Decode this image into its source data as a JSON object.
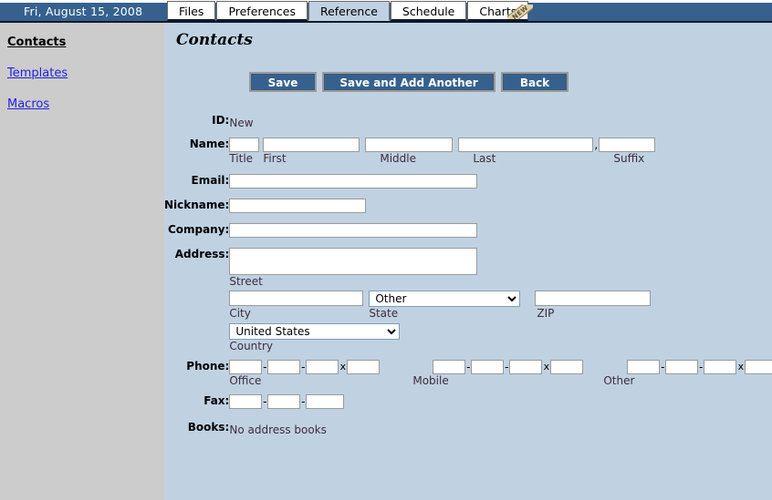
{
  "header": {
    "date": "Fri, August 15, 2008",
    "tabs": [
      {
        "label": "Files",
        "selected": false,
        "badge": null
      },
      {
        "label": "Preferences",
        "selected": false,
        "badge": null
      },
      {
        "label": "Reference",
        "selected": true,
        "badge": null
      },
      {
        "label": "Schedule",
        "selected": false,
        "badge": null
      },
      {
        "label": "Charts",
        "selected": false,
        "badge": "NEW"
      }
    ]
  },
  "sidebar": {
    "items": [
      {
        "label": "Contacts",
        "current": true
      },
      {
        "label": "Templates",
        "current": false
      },
      {
        "label": "Macros",
        "current": false
      }
    ]
  },
  "main": {
    "title": "Contacts",
    "buttons": {
      "save": "Save",
      "save_add_another": "Save and Add Another",
      "back": "Back"
    },
    "fields": {
      "id_label": "ID:",
      "id_value": "New",
      "name_label": "Name:",
      "name_title": "",
      "name_first": "",
      "name_middle": "",
      "name_last": "",
      "name_suffix": "",
      "name_separator": ",",
      "sub_title": "Title",
      "sub_first": "First",
      "sub_middle": "Middle",
      "sub_last": "Last",
      "sub_suffix": "Suffix",
      "email_label": "Email:",
      "email_value": "",
      "nickname_label": "Nickname:",
      "nickname_value": "",
      "company_label": "Company:",
      "company_value": "",
      "address_label": "Address:",
      "street_value": "",
      "sub_street": "Street",
      "city_value": "",
      "sub_city": "City",
      "state_value": "Other",
      "sub_state": "State",
      "zip_value": "",
      "sub_zip": "ZIP",
      "country_value": "United States",
      "sub_country": "Country",
      "phone_label": "Phone:",
      "phone_ext_mark": "x",
      "phone_dash": "-",
      "sub_office": "Office",
      "sub_mobile": "Mobile",
      "sub_other": "Other",
      "office_area": "",
      "office_prefix": "",
      "office_line": "",
      "office_ext": "",
      "mobile_area": "",
      "mobile_prefix": "",
      "mobile_line": "",
      "mobile_ext": "",
      "other_area": "",
      "other_prefix": "",
      "other_line": "",
      "other_ext": "",
      "fax_label": "Fax:",
      "fax_area": "",
      "fax_prefix": "",
      "fax_line": "",
      "books_label": "Books:",
      "books_value": "No address books"
    },
    "state_options": [
      "Other"
    ],
    "country_options": [
      "United States"
    ]
  },
  "colors": {
    "header_blue": "#36618e",
    "content_bg": "#c0d2e2",
    "sidebar_bg": "#cccccc",
    "link": "#2222dd",
    "button_blue": "#36618e"
  }
}
